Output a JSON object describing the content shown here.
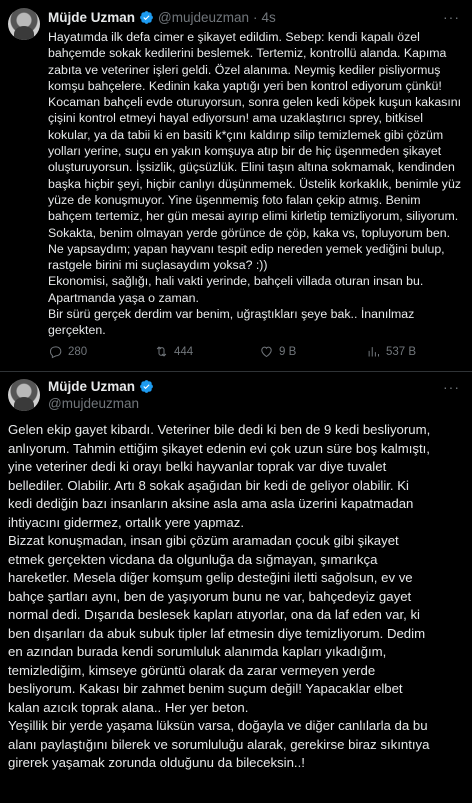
{
  "tweet1": {
    "name": "Müjde Uzman",
    "handle": "@mujdeuzman",
    "separator": "·",
    "time": "4s",
    "lines": [
      "Hayatımda ilk defa cimer e şikayet edildim. Sebep: kendi kapalı özel",
      "bahçemde sokak kedilerini beslemek. Tertemiz, kontrollü alanda. Kapıma",
      "zabıta ve veteriner işleri geldi. Özel alanıma. Neymiş kediler pisliyormuş",
      "komşu bahçelere. Kedinin kaka yaptığı yeri ben kontrol ediyorum çünkü!",
      "Kocaman bahçeli evde oturuyorsun, sonra gelen kedi köpek kuşun kakasını",
      "çişini kontrol etmeyi hayal ediyorsun! ama uzaklaştırıcı sprey, bitkisel",
      "kokular, ya da tabii ki en basiti k*çını kaldırıp silip temizlemek gibi çözüm",
      "yolları yerine, suçu en yakın komşuya atıp bir de hiç üşenmeden şikayet",
      "oluşturuyorsun. İşsizlik, güçsüzlük. Elini taşın altına sokmamak, kendinden",
      "başka hiçbir şeyi, hiçbir canlıyı düşünmemek. Üstelik korkaklık, benimle yüz",
      "yüze de konuşmuyor. Yine üşenmemiş foto falan çekip atmış. Benim",
      "bahçem tertemiz, her gün mesai ayırıp elimi kirletip temizliyorum, siliyorum.",
      "Sokakta, benim olmayan yerde görünce de çöp, kaka vs, topluyorum ben.",
      "Ne yapsaydım; yapan hayvanı tespit edip nereden yemek yediğini bulup,",
      "rastgele birini mi suçlasaydım yoksa? :))",
      "Ekonomisi, sağlığı, hali vakti yerinde, bahçeli villada oturan insan bu.",
      "Apartmanda yaşa o zaman.",
      "Bir sürü gerçek derdim var benim, uğraştıkları şeye bak.. İnanılmaz",
      "gerçekten."
    ],
    "stats": {
      "replies": "280",
      "retweets": "444",
      "likes": "9 B",
      "views": "537 B"
    }
  },
  "tweet2": {
    "name": "Müjde Uzman",
    "handle": "@mujdeuzman",
    "lines": [
      "Gelen ekip gayet kibardı. Veteriner bile dedi ki ben de 9 kedi besliyorum,",
      "anlıyorum. Tahmin ettiğim şikayet edenin evi çok uzun süre boş kalmıştı,",
      "yine veteriner dedi ki orayı belki hayvanlar toprak var diye tuvalet",
      "bellediler. Olabilir. Artı 8 sokak aşağıdan bir kedi de geliyor olabilir. Ki",
      "kedi dediğin bazı insanların aksine asla ama asla üzerini kapatmadan",
      "ihtiyacını gidermez, ortalık yere yapmaz.",
      "Bizzat konuşmadan, insan gibi çözüm aramadan çocuk gibi şikayet",
      "etmek gerçekten vicdana da olgunluğa da sığmayan, şımarıkça",
      "hareketler. Mesela diğer komşum gelip desteğini iletti sağolsun, ev ve",
      "bahçe şartları aynı, ben de yaşıyorum bunu ne var, bahçedeyiz gayet",
      "normal dedi. Dışarıda beslesek kapları atıyorlar, ona da laf eden var, ki",
      "ben dışarıları da abuk subuk tipler laf etmesin diye temizliyorum. Dedim",
      "en azından burada kendi sorumluluk alanımda kapları yıkadığım,",
      "temizlediğim, kimseye görüntü olarak da zarar vermeyen yerde",
      "besliyorum. Kakası bir zahmet benim suçum değil! Yapacaklar elbet",
      "kalan azıcık toprak alana.. Her yer beton.",
      "Yeşillik bir yerde yaşama lüksün varsa, doğayla ve diğer canlılarla da bu",
      "alanı paylaştığını bilerek ve sorumluluğu alarak, gerekirse biraz sıkıntıya",
      "girerek yaşamak zorunda olduğunu da bileceksin..!"
    ]
  },
  "colors": {
    "background": "#000000",
    "text": "#e7e9ea",
    "secondary": "#71767b",
    "verified": "#1d9bf0",
    "divider": "#2f3336"
  },
  "icons": [
    "verified-badge-icon",
    "more-icon",
    "reply-icon",
    "retweet-icon",
    "like-icon",
    "views-icon"
  ]
}
